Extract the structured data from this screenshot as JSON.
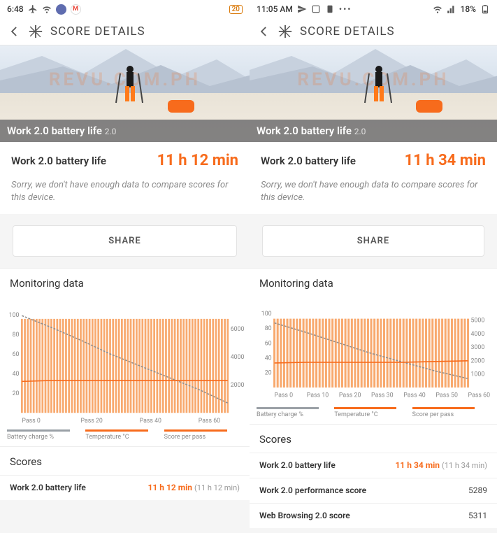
{
  "left": {
    "status": {
      "time": "6:48",
      "battery_badge": "20"
    },
    "header": {
      "title": "SCORE DETAILS"
    },
    "hero": {
      "label": "Work 2.0 battery life",
      "sub": "2.0",
      "watermark": "REVU.COM.PH"
    },
    "result": {
      "label": "Work 2.0 battery life",
      "value": "11 h 12 min"
    },
    "sorry": "Sorry, we don't have enough data to compare scores for this device.",
    "share": "SHARE",
    "monitoring": "Monitoring data",
    "legend": {
      "a": "Battery charge %",
      "b": "Temperature °C",
      "c": "Score per pass"
    },
    "scores_title": "Scores",
    "scores": [
      {
        "name": "Work 2.0 battery life",
        "value": "11 h 12 min",
        "sub": "(11 h 12 min)",
        "orange": true
      }
    ]
  },
  "right": {
    "status": {
      "time": "11:05 AM",
      "battery_pct": "18%"
    },
    "header": {
      "title": "SCORE DETAILS"
    },
    "hero": {
      "label": "Work 2.0 battery life",
      "sub": "2.0",
      "watermark": "REVU.COM.PH"
    },
    "result": {
      "label": "Work 2.0 battery life",
      "value": "11 h 34 min"
    },
    "sorry": "Sorry, we don't have enough data to compare scores for this device.",
    "share": "SHARE",
    "monitoring": "Monitoring data",
    "legend": {
      "a": "Battery charge %",
      "b": "Temperature °C",
      "c": "Score per pass"
    },
    "scores_title": "Scores",
    "scores": [
      {
        "name": "Work 2.0 battery life",
        "value": "11 h 34 min",
        "sub": "(11 h 34 min)",
        "orange": true
      },
      {
        "name": "Work 2.0 performance score",
        "value": "5289"
      },
      {
        "name": "Web Browsing 2.0 score",
        "value": "5311"
      }
    ]
  },
  "chart_data": [
    {
      "type": "line",
      "title": "Monitoring data (left)",
      "xlabel": "Pass",
      "ylabel_left": "%",
      "ylabel_right": "Score",
      "xlim": [
        0,
        70
      ],
      "ylim_left": [
        0,
        100
      ],
      "ylim_right": [
        0,
        7000
      ],
      "xticks": [
        0,
        20,
        40,
        60
      ],
      "yticks_left": [
        20,
        40,
        60,
        80,
        100
      ],
      "yticks_right": [
        2000,
        4000,
        6000
      ],
      "series": [
        {
          "name": "Battery charge %",
          "axis": "left",
          "x": [
            0,
            10,
            20,
            30,
            40,
            50,
            60,
            70
          ],
          "y": [
            99,
            87,
            74,
            60,
            48,
            36,
            24,
            10
          ]
        },
        {
          "name": "Temperature °C",
          "axis": "left",
          "x": [
            0,
            10,
            20,
            30,
            40,
            50,
            60,
            70
          ],
          "y": [
            32,
            33,
            33,
            33,
            33,
            33,
            33,
            33
          ]
        },
        {
          "name": "Score per pass",
          "axis": "right",
          "x": [
            0,
            10,
            20,
            30,
            40,
            50,
            60,
            70
          ],
          "y": [
            6700,
            6700,
            6700,
            6700,
            6700,
            6700,
            6700,
            6700
          ]
        }
      ]
    },
    {
      "type": "line",
      "title": "Monitoring data (right)",
      "xlabel": "Pass",
      "ylabel_left": "%",
      "ylabel_right": "Score",
      "xlim": [
        0,
        60
      ],
      "ylim_left": [
        0,
        100
      ],
      "ylim_right": [
        0,
        5500
      ],
      "xticks": [
        0,
        10,
        20,
        30,
        40,
        50,
        60
      ],
      "yticks_left": [
        20,
        40,
        60,
        80,
        100
      ],
      "yticks_right": [
        1000,
        2000,
        3000,
        4000,
        5000
      ],
      "series": [
        {
          "name": "Battery charge %",
          "axis": "left",
          "x": [
            0,
            10,
            20,
            30,
            40,
            50,
            60
          ],
          "y": [
            87,
            74,
            60,
            46,
            34,
            22,
            12
          ]
        },
        {
          "name": "Temperature °C",
          "axis": "left",
          "x": [
            0,
            10,
            20,
            30,
            40,
            50,
            60
          ],
          "y": [
            33,
            34,
            34,
            34,
            34,
            35,
            36
          ]
        },
        {
          "name": "Score per pass",
          "axis": "right",
          "x": [
            0,
            10,
            20,
            30,
            40,
            50,
            60
          ],
          "y": [
            5100,
            5100,
            5100,
            5100,
            5100,
            5100,
            5100
          ]
        }
      ]
    }
  ]
}
